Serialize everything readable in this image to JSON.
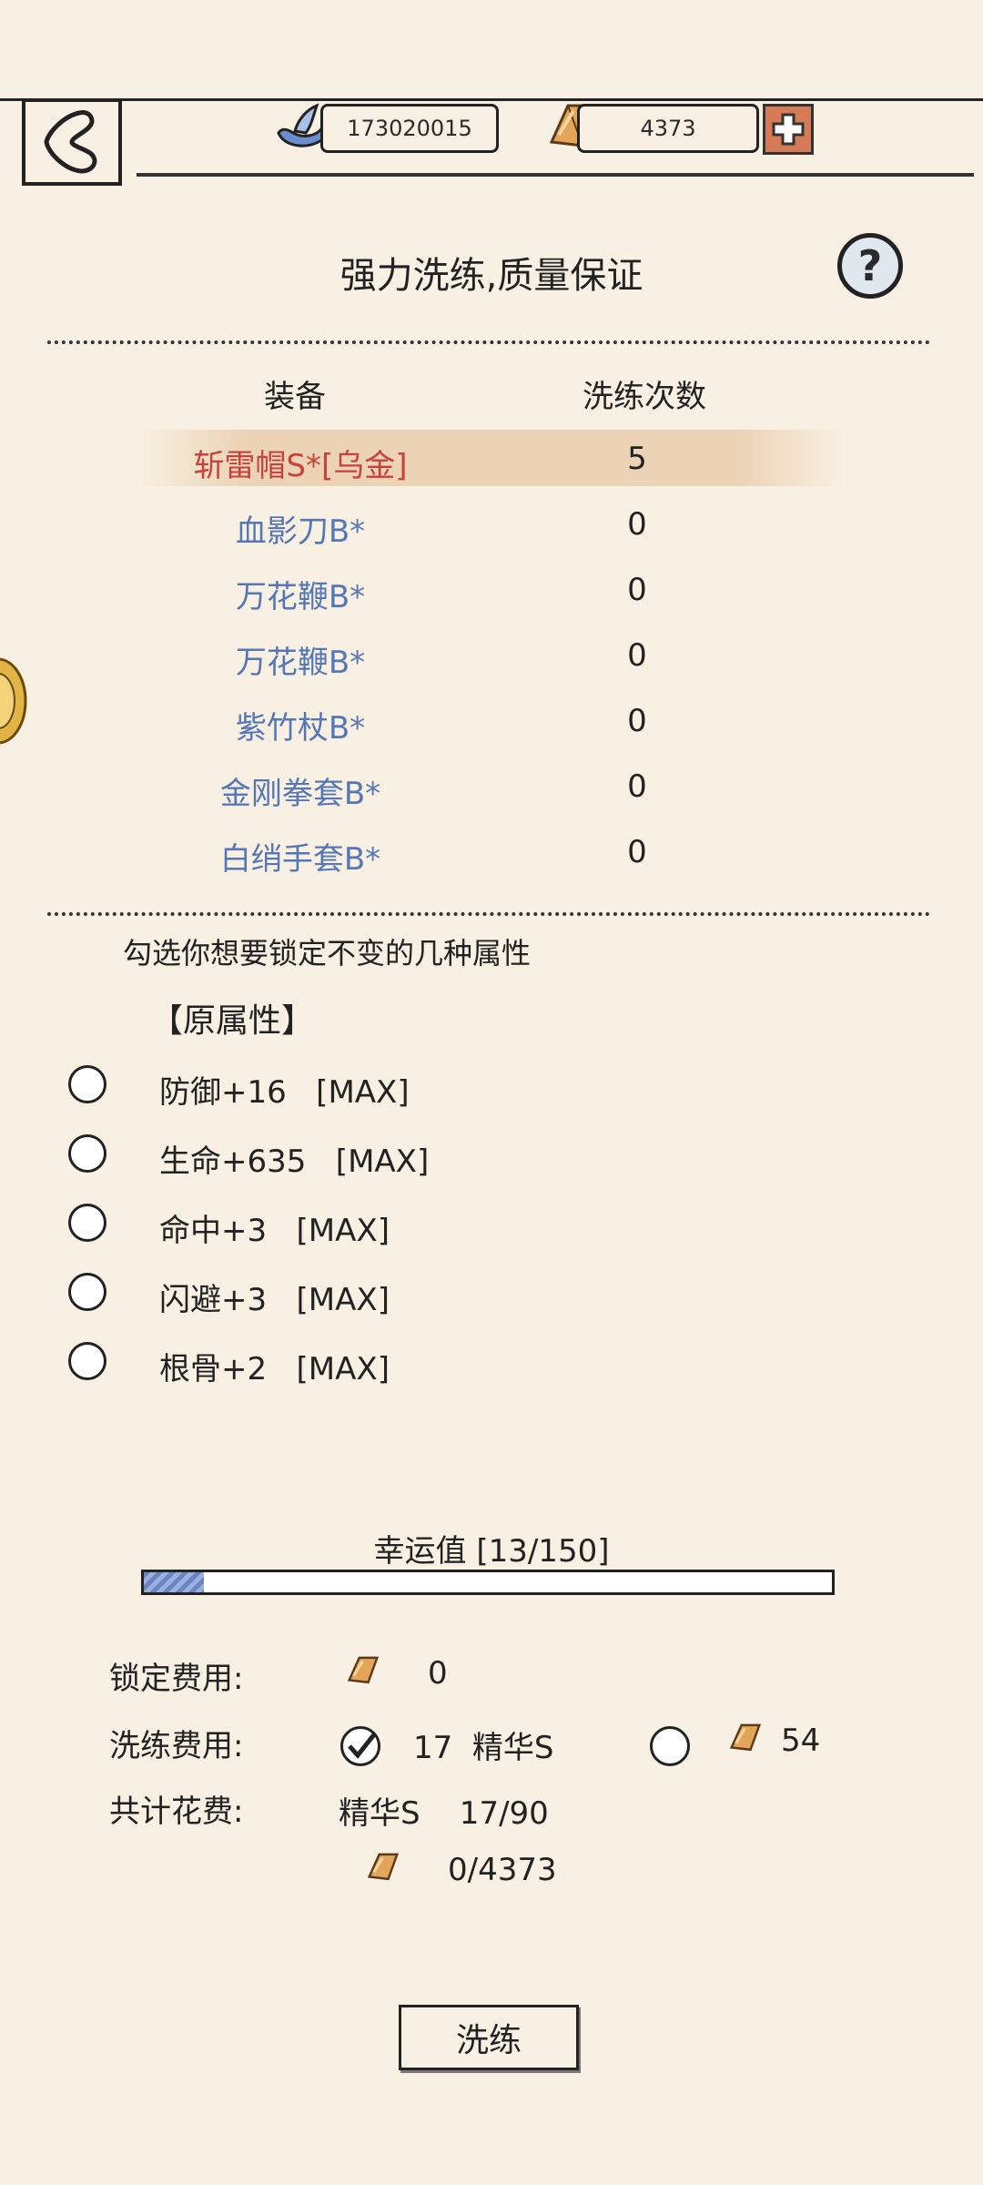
{
  "header": {
    "silver_amount": "173020015",
    "gold_amount": "4373"
  },
  "title": "强力洗练,质量保证",
  "table": {
    "col_equipment": "装备",
    "col_count": "洗练次数",
    "rows": [
      {
        "name": "斩雷帽S*[乌金]",
        "count": "5"
      },
      {
        "name": "血影刀B*",
        "count": "0"
      },
      {
        "name": "万花鞭B*",
        "count": "0"
      },
      {
        "name": "万花鞭B*",
        "count": "0"
      },
      {
        "name": "紫竹杖B*",
        "count": "0"
      },
      {
        "name": "金刚拳套B*",
        "count": "0"
      },
      {
        "name": "白绡手套B*",
        "count": "0"
      }
    ]
  },
  "lock_prompt": "勾选你想要锁定不变的几种属性",
  "original_attrs_title": "【原属性】",
  "attributes": [
    {
      "text": "防御+16   [MAX]"
    },
    {
      "text": "生命+635   [MAX]"
    },
    {
      "text": "命中+3   [MAX]"
    },
    {
      "text": "闪避+3   [MAX]"
    },
    {
      "text": "根骨+2   [MAX]"
    }
  ],
  "luck": {
    "label": "幸运值  [13/150]",
    "current": 13,
    "max": 150
  },
  "costs": {
    "lock_label": "锁定费用:",
    "lock_value": "0",
    "wash_label": "洗练费用:",
    "wash_essence_value": "17  精华S",
    "wash_gold_value": "54",
    "total_label": "共计花费:",
    "total_essence": "精华S    17/90",
    "total_gold": "0/4373"
  },
  "wash_button": "洗练",
  "colors": {
    "background": "#f8f1e3",
    "selected_item": "#c8423a",
    "item_blue": "#5577b6",
    "highlight": "#ecd3b6",
    "plus_button": "#d67b58"
  }
}
